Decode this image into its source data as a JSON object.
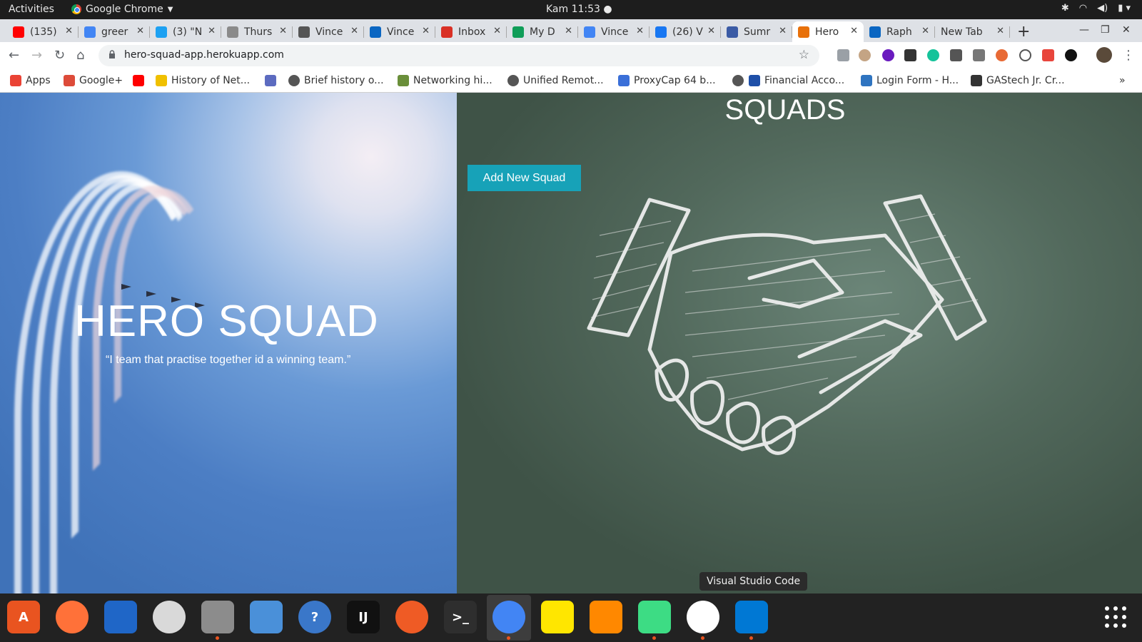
{
  "topbar": {
    "activities": "Activities",
    "app_name": "Google Chrome",
    "clock": "Kam 11:53"
  },
  "tabs": [
    {
      "label": "(135)",
      "icon": "youtube-icon",
      "color": "#ff0000"
    },
    {
      "label": "greer",
      "icon": "google-icon",
      "color": "#4285f4"
    },
    {
      "label": "(3) \"N",
      "icon": "twitter-icon",
      "color": "#1da1f2"
    },
    {
      "label": "Thurs",
      "icon": "palm-icon",
      "color": "#8a8a8a"
    },
    {
      "label": "Vince",
      "icon": "globe-icon",
      "color": "#555555"
    },
    {
      "label": "Vince",
      "icon": "linkedin-icon",
      "color": "#0a66c2"
    },
    {
      "label": "Inbox",
      "icon": "gmail-icon",
      "color": "#d93025"
    },
    {
      "label": "My D",
      "icon": "drive-icon",
      "color": "#0f9d58"
    },
    {
      "label": "Vince",
      "icon": "docs-icon",
      "color": "#4285f4"
    },
    {
      "label": "(26) V",
      "icon": "facebook-icon",
      "color": "#1877f2"
    },
    {
      "label": "Sumr",
      "icon": "p-icon",
      "color": "#3b5ba5"
    },
    {
      "label": "Hero",
      "icon": "hero-favicon-icon",
      "color": "#e8710a",
      "active": true
    },
    {
      "label": "Raph",
      "icon": "linkedin-icon",
      "color": "#0a66c2"
    },
    {
      "label": "New Tab",
      "icon": "",
      "color": ""
    }
  ],
  "address_bar": {
    "url": "hero-squad-app.herokuapp.com"
  },
  "bookmarks": [
    {
      "label": "Apps",
      "icon": "apps-grid-icon",
      "color": "#ea4335"
    },
    {
      "label": "Google+",
      "icon": "google-plus-icon",
      "color": "#dd4b39"
    },
    {
      "label": "",
      "icon": "youtube-icon",
      "color": "#ff0000"
    },
    {
      "label": "History of Net...",
      "icon": "history-icon",
      "color": "#f0c000"
    },
    {
      "label": "",
      "icon": "doc-icon",
      "color": "#5c6bc0"
    },
    {
      "label": "Brief history o...",
      "icon": "globe-icon",
      "color": "#555555"
    },
    {
      "label": "Networking hi...",
      "icon": "network-icon",
      "color": "#6a8f3a"
    },
    {
      "label": "Unified Remot...",
      "icon": "globe-icon",
      "color": "#555555"
    },
    {
      "label": "ProxyCap 64 b...",
      "icon": "proxycap-icon",
      "color": "#3a6fd8"
    },
    {
      "label": "",
      "icon": "globe-icon",
      "color": "#555555"
    },
    {
      "label": "Financial Acco...",
      "icon": "finance-icon",
      "color": "#1e4fa8"
    },
    {
      "label": "Login Form - H...",
      "icon": "css-icon",
      "color": "#2f74c0"
    },
    {
      "label": "GAStech Jr. Cr...",
      "icon": "wikipedia-icon",
      "color": "#333333"
    }
  ],
  "hero": {
    "title": "HERO SQUAD",
    "quote": "“I team that practise together id a winning team.”"
  },
  "squads": {
    "title": "SQUADS",
    "add_button": "Add New Squad"
  },
  "tooltip": "Visual Studio Code",
  "dock": [
    {
      "name": "software-center-icon",
      "color": "#e95420",
      "glyph": "A"
    },
    {
      "name": "firefox-icon",
      "color": "#ff7139",
      "glyph": ""
    },
    {
      "name": "thunderbird-icon",
      "color": "#1f66c7",
      "glyph": ""
    },
    {
      "name": "rhythmbox-icon",
      "color": "#d9d9d9",
      "glyph": ""
    },
    {
      "name": "files-icon",
      "color": "#8c8c8c",
      "glyph": ""
    },
    {
      "name": "image-viewer-icon",
      "color": "#4a90d9",
      "glyph": ""
    },
    {
      "name": "help-icon",
      "color": "#3a77c9",
      "glyph": "?"
    },
    {
      "name": "intellij-icon",
      "color": "#111111",
      "glyph": "IJ"
    },
    {
      "name": "postman-icon",
      "color": "#ef5b25",
      "glyph": ""
    },
    {
      "name": "terminal-icon",
      "color": "#2e2e2e",
      "glyph": ">_"
    },
    {
      "name": "chrome-icon",
      "color": "#4285f4",
      "glyph": ""
    },
    {
      "name": "notes-icon",
      "color": "#ffe600",
      "glyph": ""
    },
    {
      "name": "vlc-icon",
      "color": "#ff8800",
      "glyph": ""
    },
    {
      "name": "android-studio-icon",
      "color": "#3ddc84",
      "glyph": ""
    },
    {
      "name": "slack-icon",
      "color": "#ffffff",
      "glyph": ""
    },
    {
      "name": "vscode-icon",
      "color": "#0078d4",
      "glyph": ""
    }
  ]
}
